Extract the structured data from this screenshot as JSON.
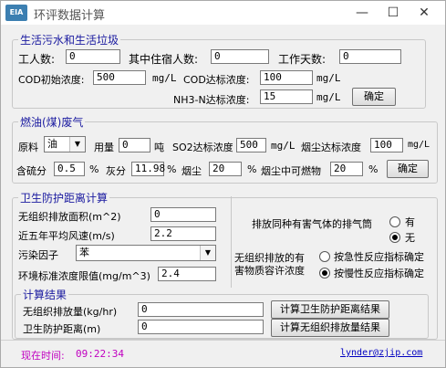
{
  "window": {
    "title": "环评数据计算",
    "icon_text": "EIA",
    "minimize": "—",
    "maximize": "☐",
    "close": "✕"
  },
  "sewage": {
    "legend": "生活污水和生活垃圾",
    "workers_label": "工人数:",
    "workers_value": "0",
    "residents_label": "其中住宿人数:",
    "residents_value": "0",
    "days_label": "工作天数:",
    "days_value": "0",
    "cod_init_label": "COD初始浓度:",
    "cod_init_value": "500",
    "cod_init_unit": "mg/L",
    "cod_std_label": "COD达标浓度:",
    "cod_std_value": "100",
    "cod_std_unit": "mg/L",
    "nh3_label": "NH3-N达标浓度:",
    "nh3_value": "15",
    "nh3_unit": "mg/L",
    "confirm": "确定"
  },
  "fuel": {
    "legend": "燃油(煤)废气",
    "material_label": "原料",
    "material_value": "油",
    "usage_label": "用量",
    "usage_value": "0",
    "usage_unit": "吨",
    "so2_label": "SO2达标浓度",
    "so2_value": "500",
    "so2_unit": "mg/L",
    "dust_std_label": "烟尘达标浓度",
    "dust_std_value": "100",
    "dust_std_unit": "mg/L",
    "sulfur_label": "含硫分",
    "sulfur_value": "0.5",
    "sulfur_unit": "%",
    "ash_label": "灰分",
    "ash_value": "11.98",
    "ash_unit": "%",
    "soot_label": "烟尘",
    "soot_value": "20",
    "soot_unit": "%",
    "combustible_label": "烟尘中可燃物",
    "combustible_value": "20",
    "combustible_unit": "%",
    "confirm": "确定"
  },
  "protection": {
    "legend": "卫生防护距离计算",
    "area_label": "无组织排放面积(m^2)",
    "area_value": "0",
    "wind_label": "近五年平均风速(m/s)",
    "wind_value": "2.2",
    "pollutant_label": "污染因子",
    "pollutant_value": "苯",
    "limit_label": "环境标准浓度限值(mg/m^3)",
    "limit_value": "2.4",
    "stack_question": "排放同种有害气体的排气筒",
    "stack_yes": "有",
    "stack_no": "无",
    "allow_label_1": "无组织排放的有",
    "allow_label_2": "害物质容许浓度",
    "acute_label": "按急性反应指标确定",
    "chronic_label": "按慢性反应指标确定"
  },
  "results": {
    "legend": "计算结果",
    "emission_label": "无组织排放量(kg/hr)",
    "emission_value": "0",
    "distance_label": "卫生防护距离(m)",
    "distance_value": "0",
    "calc_distance_button": "计算卫生防护距离结果",
    "calc_emission_button": "计算无组织排放量结果"
  },
  "status": {
    "time_label": "现在时间:",
    "time_value": "09:22:34",
    "email": "lynder@zjip.com"
  },
  "colors": {
    "legend": "#1a1aa0",
    "time_label": "#c000c0",
    "email": "#0000c0"
  }
}
